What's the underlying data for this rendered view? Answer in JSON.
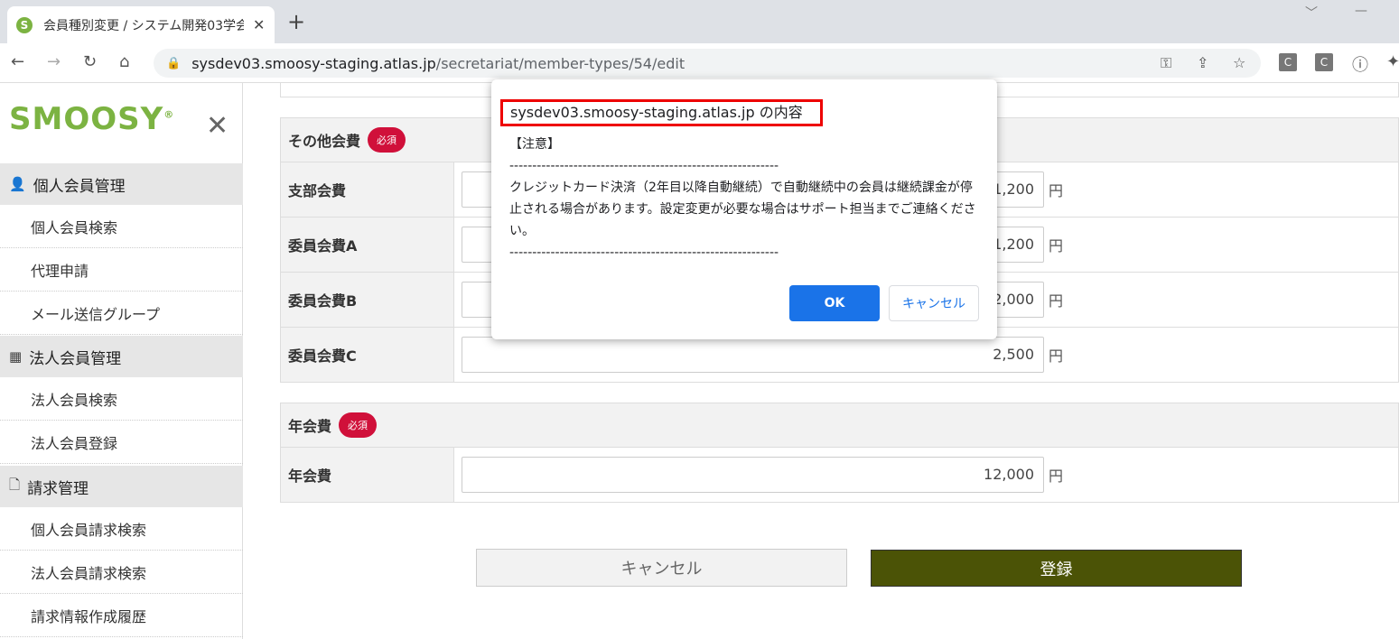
{
  "browser": {
    "tab_title": "会員種別変更 / システム開発03学会",
    "favicon_letter": "S",
    "url_host": "sysdev03.smoosy-staging.atlas.jp",
    "url_path": "/secretariat/member-types/54/edit",
    "ext1": "C",
    "ext2": "C"
  },
  "sidebar": {
    "logo": "SMOOSY",
    "logo_reg": "®",
    "sections": [
      {
        "label": "個人会員管理",
        "icon": "person-icon",
        "items": [
          "個人会員検索",
          "代理申請",
          "メール送信グループ"
        ]
      },
      {
        "label": "法人会員管理",
        "icon": "building-icon",
        "items": [
          "法人会員検索",
          "法人会員登録"
        ]
      },
      {
        "label": "請求管理",
        "icon": "document-icon",
        "items": [
          "個人会員請求検索",
          "法人会員請求検索",
          "請求情報作成履歴"
        ]
      }
    ]
  },
  "form": {
    "other_fees": {
      "title": "その他会費",
      "required": "必須",
      "rows": [
        {
          "label": "支部会費",
          "value": "1,200",
          "unit": "円"
        },
        {
          "label": "委員会費A",
          "value": "1,200",
          "unit": "円"
        },
        {
          "label": "委員会費B",
          "value": "2,000",
          "unit": "円"
        },
        {
          "label": "委員会費C",
          "value": "2,500",
          "unit": "円"
        }
      ]
    },
    "annual": {
      "title": "年会費",
      "required": "必須",
      "row": {
        "label": "年会費",
        "value": "12,000",
        "unit": "円"
      }
    },
    "cancel_label": "キャンセル",
    "submit_label": "登録"
  },
  "dialog": {
    "title": "sysdev03.smoosy-staging.atlas.jp の内容",
    "line1": "【注意】",
    "separator": "-----------------------------------------------------------",
    "message": "クレジットカード決済（2年目以降自動継続）で自動継続中の会員は継続課金が停止される場合があります。設定変更が必要な場合はサポート担当までご連絡ください。",
    "ok_label": "OK",
    "cancel_label": "キャンセル"
  }
}
